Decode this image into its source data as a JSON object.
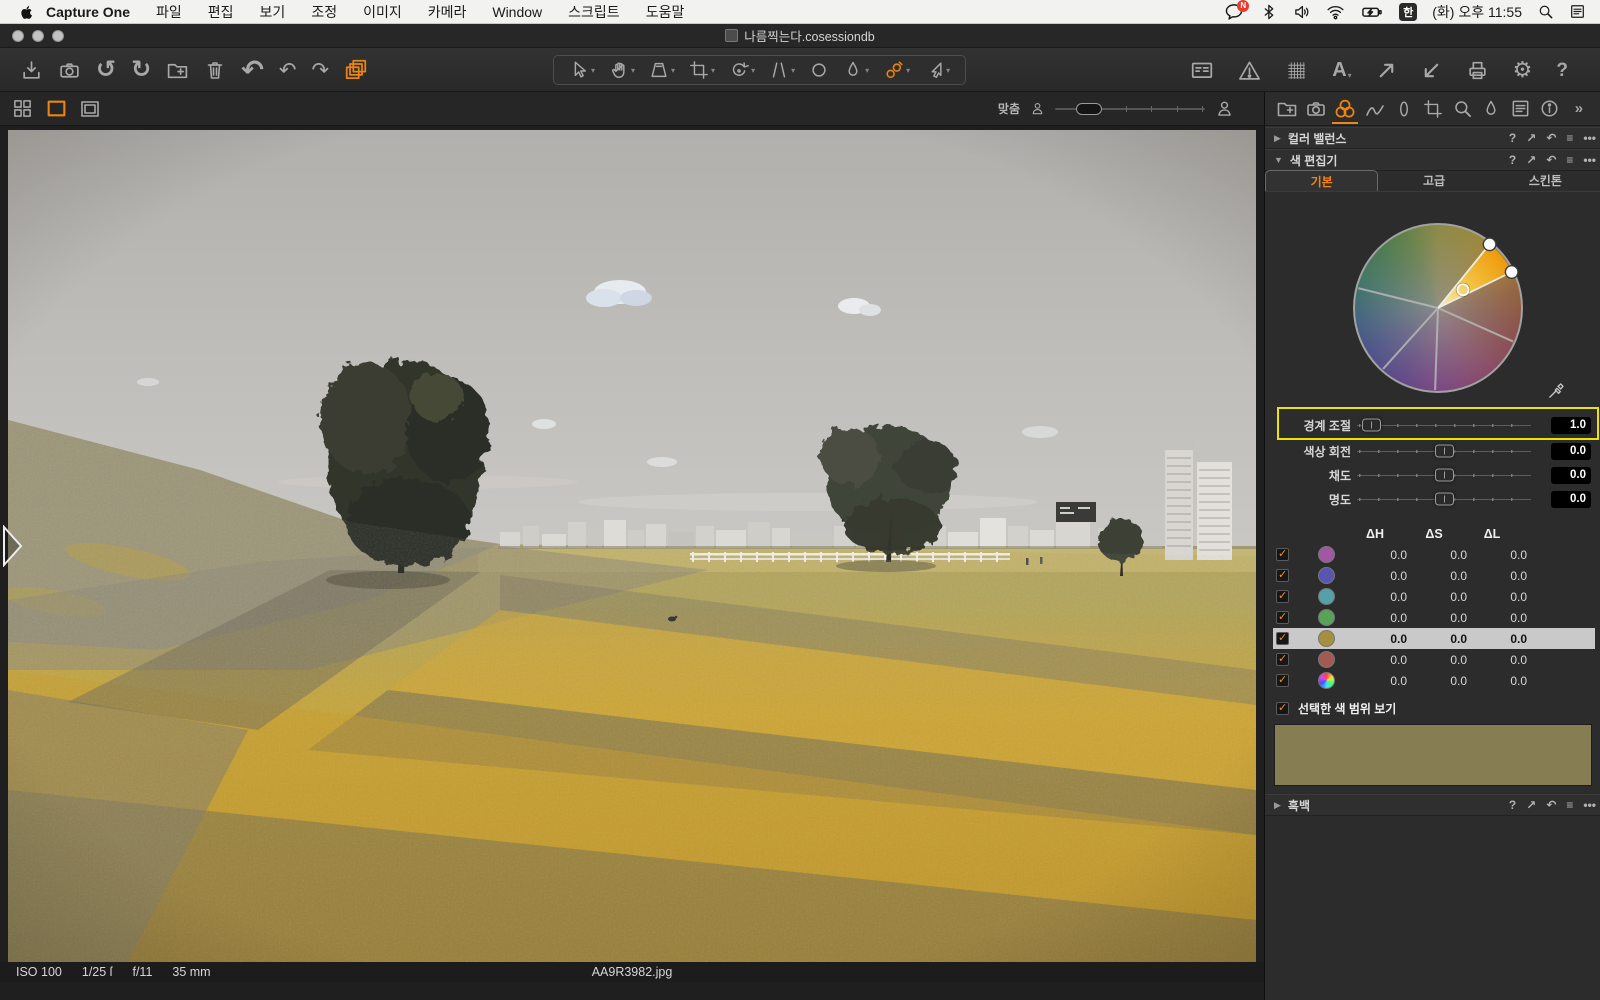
{
  "menu_bar": {
    "app_name": "Capture One",
    "items": [
      "파일",
      "편집",
      "보기",
      "조정",
      "이미지",
      "카메라",
      "Window",
      "스크립트",
      "도움말"
    ],
    "input_badge": "한",
    "clock": "(화) 오후 11:55"
  },
  "window": {
    "title": "나름찍는다.cosessiondb"
  },
  "viewer": {
    "fit_label": "맞춤"
  },
  "status_bar": {
    "iso": "ISO 100",
    "shutter": "1/25 ſ",
    "aperture": "f/11",
    "focal_length": "35 mm",
    "filename": "AA9R3982.jpg"
  },
  "panel": {
    "sections": {
      "color_balance": "컬러 밸런스",
      "color_editor": "색 편집기",
      "black_white": "흑백"
    },
    "tabs": [
      {
        "label": "기본",
        "active": true
      },
      {
        "label": "고급",
        "active": false
      },
      {
        "label": "스킨톤",
        "active": false
      }
    ],
    "sliders": [
      {
        "label": "경계 조절",
        "value": "1.0",
        "knob": 0.03,
        "highlighted": true
      },
      {
        "label": "색상 회전",
        "value": "0.0",
        "knob": 0.5,
        "highlighted": false
      },
      {
        "label": "채도",
        "value": "0.0",
        "knob": 0.5,
        "highlighted": false
      },
      {
        "label": "명도",
        "value": "0.0",
        "knob": 0.5,
        "highlighted": false
      }
    ],
    "table": {
      "headers": [
        "ΔH",
        "ΔS",
        "ΔL"
      ],
      "rows": [
        {
          "color": "#a257a5",
          "values": [
            "0.0",
            "0.0",
            "0.0"
          ],
          "selected": false
        },
        {
          "color": "#5a55b2",
          "values": [
            "0.0",
            "0.0",
            "0.0"
          ],
          "selected": false
        },
        {
          "color": "#54a1a9",
          "values": [
            "0.0",
            "0.0",
            "0.0"
          ],
          "selected": false
        },
        {
          "color": "#57a457",
          "values": [
            "0.0",
            "0.0",
            "0.0"
          ],
          "selected": false
        },
        {
          "color": "#a68e3f",
          "values": [
            "0.0",
            "0.0",
            "0.0"
          ],
          "selected": true
        },
        {
          "color": "#a35a50",
          "values": [
            "0.0",
            "0.0",
            "0.0"
          ],
          "selected": false
        },
        {
          "color": "conic-gradient(#ff4040,#ffe040,#40ff70,#40e0ff,#4050ff,#e040ff,#ff4040)",
          "values": [
            "0.0",
            "0.0",
            "0.0"
          ],
          "selected": false
        }
      ]
    },
    "view_range_label": "선택한 색 범위 보기",
    "swatch_color": "#867d52"
  },
  "colors": {
    "accent": "#ee8511",
    "highlight_outline": "#ece400",
    "selected_row": "#c9c9c9"
  },
  "icons": {
    "rotate_ccw": "↺",
    "rotate_cw": "↻",
    "undo_big": "↶",
    "undo": "↶",
    "redo": "↷",
    "help": "?",
    "expand": "↗",
    "reset": "↶",
    "preset_menu": "≡",
    "more": "•••",
    "dropdown": "▾",
    "collapsed_arrow": "▶",
    "expanded_arrow": "▼",
    "chevron_more": "»",
    "gear": "⚙",
    "question": "?",
    "letter_a": "A"
  }
}
